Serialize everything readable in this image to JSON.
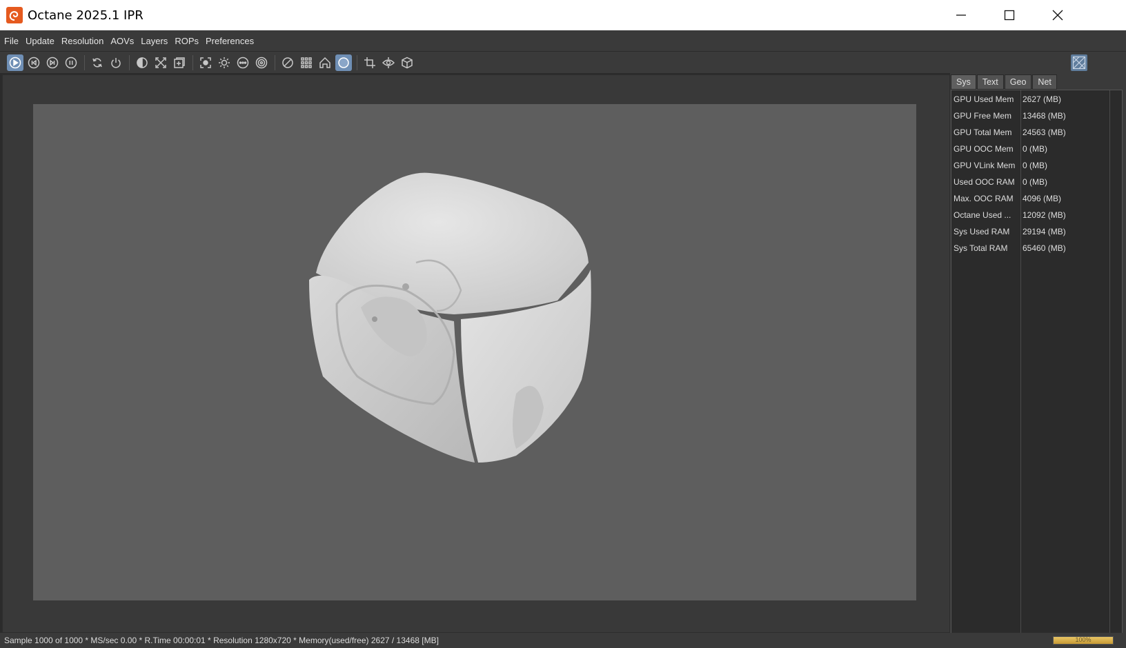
{
  "window": {
    "title": "Octane 2025.1 IPR",
    "controls": [
      "minimize-icon",
      "maximize-icon",
      "close-icon"
    ]
  },
  "menu": [
    "File",
    "Update",
    "Resolution",
    "AOVs",
    "Layers",
    "ROPs",
    "Preferences"
  ],
  "toolbar": {
    "groups": [
      [
        "play-icon",
        "skip-back-icon",
        "skip-forward-icon",
        "pause-icon"
      ],
      [
        "refresh-icon",
        "power-icon"
      ],
      [
        "contrast-icon",
        "fit-icon",
        "region-icon"
      ],
      [
        "focus-icon",
        "sun-icon",
        "dots-icon",
        "target-icon"
      ],
      [
        "no-clamp-icon",
        "grid-icon",
        "home-icon",
        "sphere-icon"
      ],
      [
        "crop-icon",
        "eye-icon",
        "cube-icon"
      ]
    ],
    "active": [
      "play-icon",
      "sphere-icon"
    ]
  },
  "side_panel": {
    "tabs": [
      "Sys",
      "Text",
      "Geo",
      "Net"
    ],
    "active_tab": "Sys",
    "stats": [
      {
        "label": "GPU Used Mem",
        "value": "2627 (MB)"
      },
      {
        "label": "GPU Free Mem",
        "value": "13468 (MB)"
      },
      {
        "label": "GPU Total Mem",
        "value": "24563 (MB)"
      },
      {
        "label": "GPU OOC Mem",
        "value": "0 (MB)"
      },
      {
        "label": "GPU VLink Mem",
        "value": "0 (MB)"
      },
      {
        "label": "Used OOC RAM",
        "value": "0 (MB)"
      },
      {
        "label": "Max. OOC RAM",
        "value": "4096 (MB)"
      },
      {
        "label": "Octane Used ...",
        "value": "12092 (MB)"
      },
      {
        "label": "Sys Used RAM",
        "value": "29194 (MB)"
      },
      {
        "label": "Sys Total RAM",
        "value": "65460 (MB)"
      }
    ]
  },
  "status": {
    "text": "Sample 1000 of 1000 * MS/sec 0.00 * R.Time 00:00:01 * Resolution 1280x720 * Memory(used/free) 2627 / 13468 [MB]",
    "progress_label": "100%",
    "progress_fraction": 1.0
  },
  "colors": {
    "accent": "#6f8fb5",
    "progress": "#d9b04a",
    "logo": "#e55a1f"
  }
}
